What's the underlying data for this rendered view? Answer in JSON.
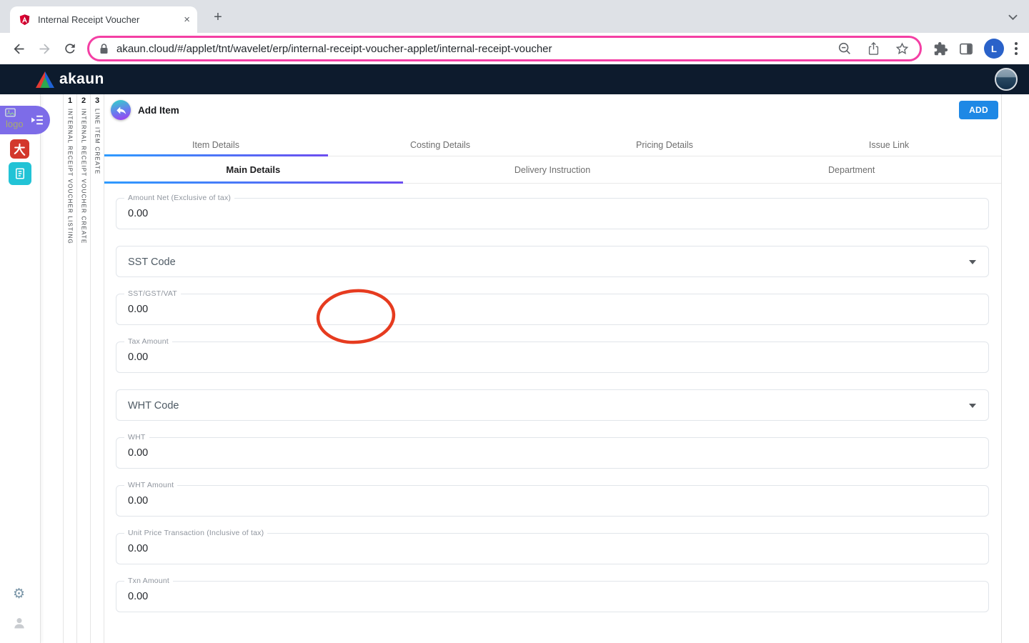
{
  "browser": {
    "tab": {
      "title": "Internal Receipt Voucher",
      "close_glyph": "×",
      "new_tab_glyph": "+"
    },
    "toolbar": {
      "url": "akaun.cloud/#/applet/tnt/wavelet/erp/internal-receipt-voucher-applet/internal-receipt-voucher",
      "avatar_letter": "L"
    }
  },
  "navbar": {
    "brand": "akaun"
  },
  "sidebar": {
    "logo_alt": "logo",
    "icons": [
      "collapse-menu-icon",
      "red-app-icon-chinese-character",
      "teal-document-app-icon",
      "gear-icon",
      "person-icon"
    ],
    "gear_glyph": "⚙"
  },
  "workspace_tabs": [
    {
      "num": "1",
      "label": "INTERNAL RECEIPT VOUCHER LISTING"
    },
    {
      "num": "2",
      "label": "INTERNAL RECEIPT VOUCHER CREATE"
    },
    {
      "num": "3",
      "label": "LINE ITEM CREATE"
    }
  ],
  "content": {
    "header": {
      "title": "Add Item",
      "add_button_label": "ADD"
    },
    "tabs_row1": {
      "active_index": 0,
      "items": [
        "Item Details",
        "Costing Details",
        "Pricing Details",
        "Issue Link"
      ]
    },
    "tabs_row2": {
      "active_index": 0,
      "items": [
        "Main Details",
        "Delivery Instruction",
        "Department"
      ]
    },
    "form_fields": [
      {
        "type": "input",
        "label": "Amount Net (Exclusive of tax)",
        "value": "0.00"
      },
      {
        "type": "select",
        "label": "SST Code"
      },
      {
        "type": "input",
        "label": "SST/GST/VAT",
        "value": "0.00"
      },
      {
        "type": "input",
        "label": "Tax Amount",
        "value": "0.00"
      },
      {
        "type": "select",
        "label": "WHT Code"
      },
      {
        "type": "input",
        "label": "WHT",
        "value": "0.00"
      },
      {
        "type": "input",
        "label": "WHT Amount",
        "value": "0.00"
      },
      {
        "type": "input",
        "label": "Unit Price Transaction (Inclusive of tax)",
        "value": "0.00"
      },
      {
        "type": "input",
        "label": "Txn Amount",
        "value": "0.00"
      }
    ]
  },
  "colors": {
    "navbar_bg": "#0d1b2d",
    "add_button_blue": "#1e88e5",
    "tab_underline_gradient": [
      "#2e9bff",
      "#6c4ef0"
    ],
    "annotation_red": "#e63b1f",
    "url_highlight_pink": "#f43fa4",
    "sidebar_pill_purple": "#7d6ce8",
    "red_app": "#d3372c",
    "teal_app": "#22c3d6"
  }
}
